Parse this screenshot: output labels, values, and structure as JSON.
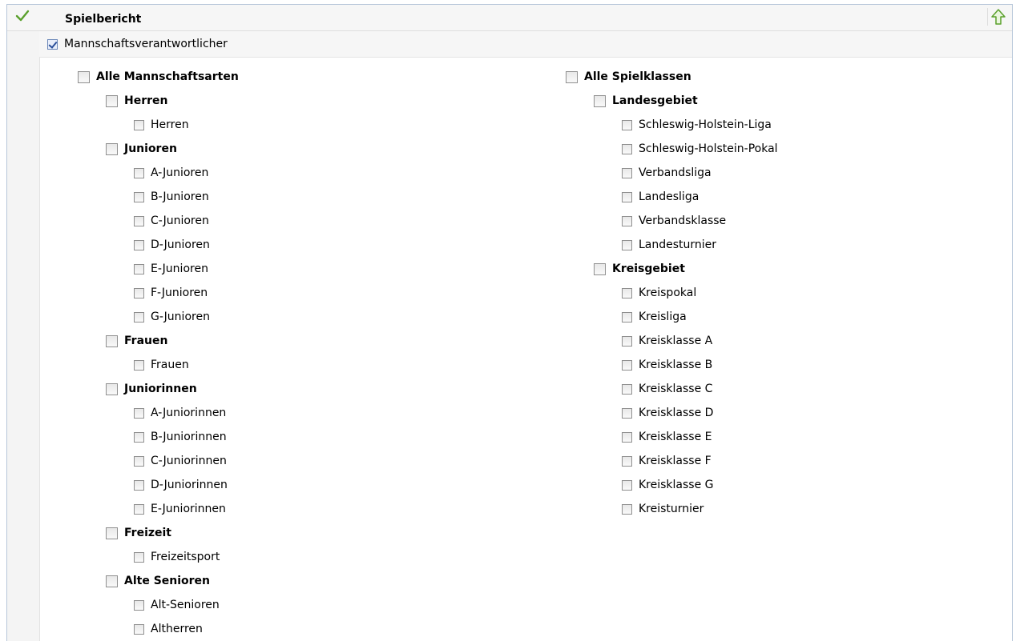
{
  "header": {
    "title": "Spielbericht",
    "role_checkbox": {
      "label": "Mannschaftsverantwortlicher",
      "checked": true
    }
  },
  "left_tree": {
    "root": "Alle Mannschaftsarten",
    "groups": [
      {
        "label": "Herren",
        "items": [
          "Herren"
        ]
      },
      {
        "label": "Junioren",
        "items": [
          "A-Junioren",
          "B-Junioren",
          "C-Junioren",
          "D-Junioren",
          "E-Junioren",
          "F-Junioren",
          "G-Junioren"
        ]
      },
      {
        "label": "Frauen",
        "items": [
          "Frauen"
        ]
      },
      {
        "label": "Juniorinnen",
        "items": [
          "A-Juniorinnen",
          "B-Juniorinnen",
          "C-Juniorinnen",
          "D-Juniorinnen",
          "E-Juniorinnen"
        ]
      },
      {
        "label": "Freizeit",
        "items": [
          "Freizeitsport"
        ]
      },
      {
        "label": "Alte Senioren",
        "items": [
          "Alt-Senioren",
          "Altherren"
        ]
      }
    ]
  },
  "right_tree": {
    "root": "Alle Spielklassen",
    "groups": [
      {
        "label": "Landesgebiet",
        "items": [
          "Schleswig-Holstein-Liga",
          "Schleswig-Holstein-Pokal",
          "Verbandsliga",
          "Landesliga",
          "Verbandsklasse",
          "Landesturnier"
        ]
      },
      {
        "label": "Kreisgebiet",
        "items": [
          "Kreispokal",
          "Kreisliga",
          "Kreisklasse A",
          "Kreisklasse B",
          "Kreisklasse C",
          "Kreisklasse D",
          "Kreisklasse E",
          "Kreisklasse F",
          "Kreisklasse G",
          "Kreisturnier"
        ]
      }
    ]
  },
  "icons": {
    "status": "checkmark-icon",
    "collapse": "up-arrow-icon"
  },
  "colors": {
    "check_green": "#5aa02c",
    "arrow_green": "#5aa02c",
    "border": "#b7c6d9"
  }
}
